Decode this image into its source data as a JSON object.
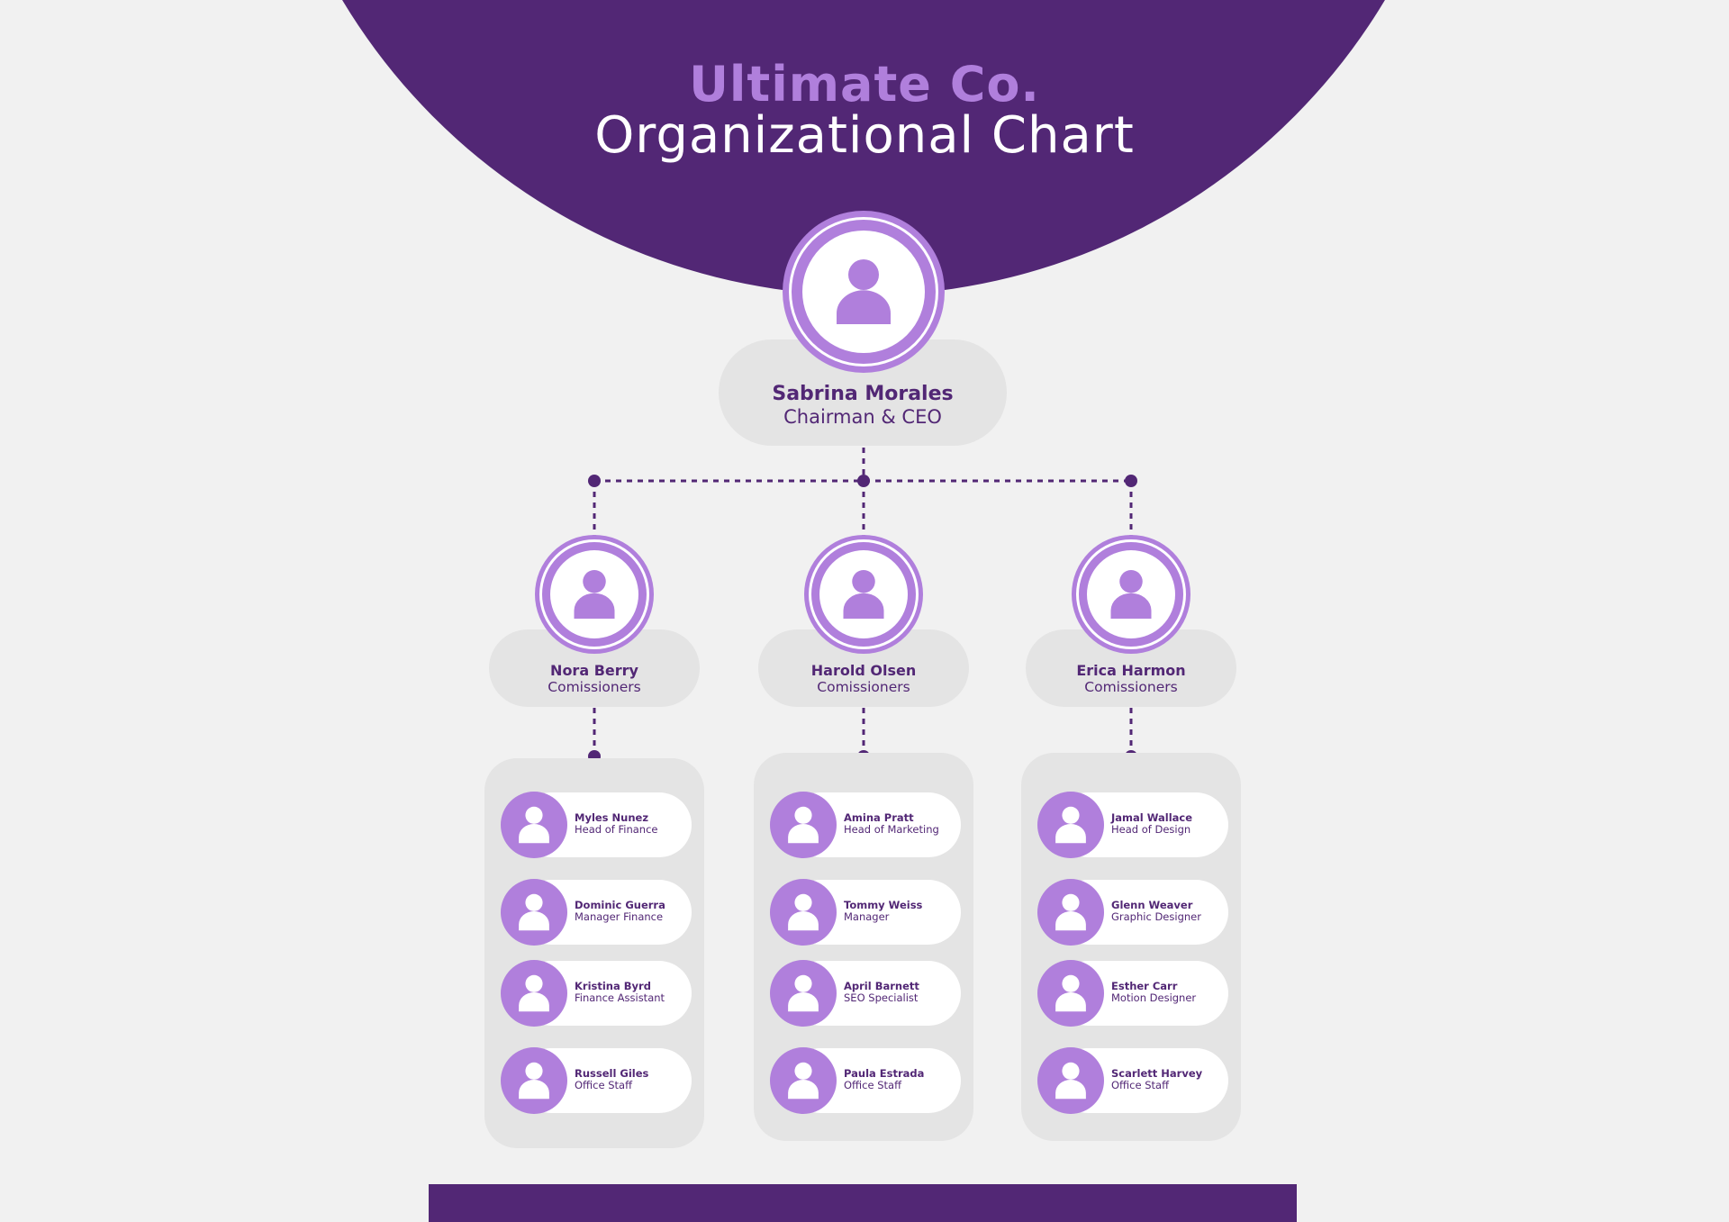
{
  "title": {
    "line1": "Ultimate Co.",
    "line2": "Organizational Chart"
  },
  "colors": {
    "primary": "#522775",
    "accent": "#b07fdc",
    "panel": "#e4e4e4",
    "background": "#f1f1f1"
  },
  "ceo": {
    "name": "Sabrina Morales",
    "role": "Chairman & CEO",
    "icon": "person-icon"
  },
  "commissioners": [
    {
      "name": "Nora Berry",
      "role": "Comissioners",
      "team": [
        {
          "name": "Myles Nunez",
          "role": "Head of Finance"
        },
        {
          "name": "Dominic Guerra",
          "role": "Manager Finance"
        },
        {
          "name": "Kristina Byrd",
          "role": "Finance Assistant"
        },
        {
          "name": "Russell Giles",
          "role": "Office Staff"
        }
      ]
    },
    {
      "name": "Harold Olsen",
      "role": "Comissioners",
      "team": [
        {
          "name": "Amina Pratt",
          "role": "Head of Marketing"
        },
        {
          "name": "Tommy Weiss",
          "role": "Manager"
        },
        {
          "name": "April Barnett",
          "role": "SEO Specialist"
        },
        {
          "name": "Paula Estrada",
          "role": "Office Staff"
        }
      ]
    },
    {
      "name": "Erica Harmon",
      "role": "Comissioners",
      "team": [
        {
          "name": "Jamal Wallace",
          "role": "Head of Design"
        },
        {
          "name": "Glenn Weaver",
          "role": "Graphic Designer"
        },
        {
          "name": "Esther Carr",
          "role": "Motion Designer"
        },
        {
          "name": "Scarlett Harvey",
          "role": "Office Staff"
        }
      ]
    }
  ]
}
